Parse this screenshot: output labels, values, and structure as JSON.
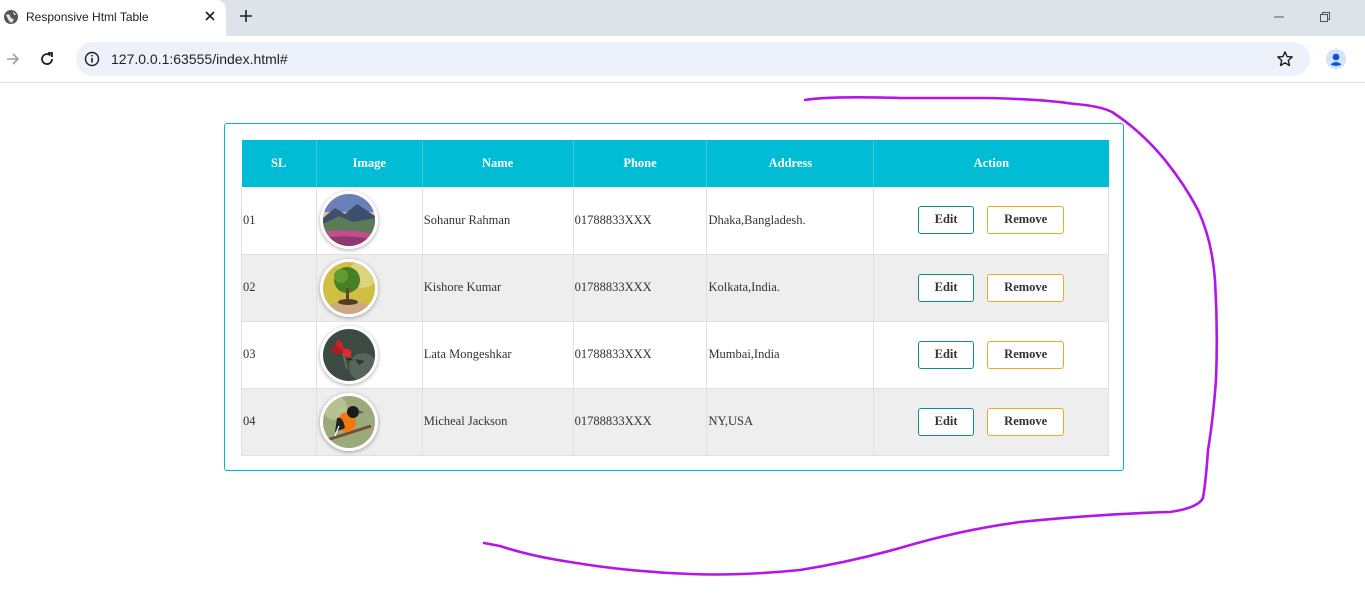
{
  "browser": {
    "tab_title": "Responsive Html Table",
    "url": "127.0.0.1:63555/index.html#"
  },
  "table": {
    "headers": [
      "SL",
      "Image",
      "Name",
      "Phone",
      "Address",
      "Action"
    ],
    "edit_label": "Edit",
    "remove_label": "Remove",
    "rows": [
      {
        "sl": "01",
        "image": "mountain-landscape",
        "name": "Sohanur Rahman",
        "phone": "01788833XXX",
        "address": "Dhaka,Bangladesh."
      },
      {
        "sl": "02",
        "image": "tree-in-hand",
        "name": "Kishore Kumar",
        "phone": "01788833XXX",
        "address": "Kolkata,India."
      },
      {
        "sl": "03",
        "image": "red-flower-hummingbird",
        "name": "Lata Mongeshkar",
        "phone": "01788833XXX",
        "address": "Mumbai,India"
      },
      {
        "sl": "04",
        "image": "oriole-bird",
        "name": "Micheal Jackson",
        "phone": "01788833XXX",
        "address": "NY,USA"
      }
    ]
  },
  "colors": {
    "header_bg": "#00bcd4",
    "card_border": "#00b7cf",
    "edit_border": "#118a8a",
    "remove_border": "#f0a81e",
    "annotation_stroke": "#b516e8"
  }
}
